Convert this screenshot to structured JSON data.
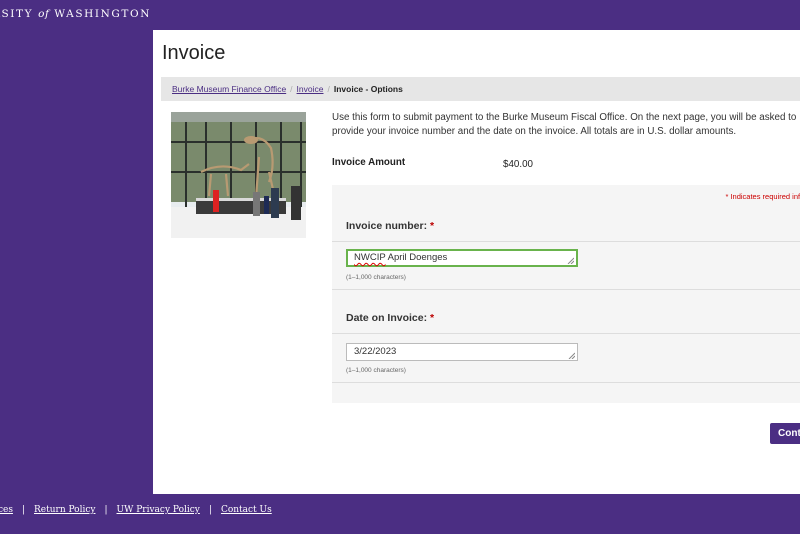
{
  "header": {
    "org_text_start": "RSITY ",
    "org_of": "of",
    "org_text_end": " WASHINGTON"
  },
  "page": {
    "title": "Invoice"
  },
  "breadcrumb": {
    "items": [
      "Burke Museum Finance Office",
      "Invoice"
    ],
    "current": "Invoice - Options",
    "separator": "/"
  },
  "intro_text": "Use this form to submit payment to the Burke Museum Fiscal Office. On the next page, you will be asked to provide your invoice number and the date on the invoice. All totals are in U.S. dollar amounts.",
  "invoice_amount": {
    "label": "Invoice Amount",
    "value": "$40.00"
  },
  "form": {
    "required_note": "* Indicates required inform",
    "questions": [
      {
        "label": "Invoice number:",
        "required": "*",
        "value_underlined": "NWCIP",
        "value_rest": " April Doenges",
        "hint": "(1–1,000 characters)"
      },
      {
        "label": "Date on Invoice:",
        "required": "*",
        "value": "3/22/2023",
        "hint": "(1–1,000 characters)"
      }
    ]
  },
  "continue_label": "Continue",
  "footer": {
    "links": [
      "vices",
      "Return Policy",
      "UW Privacy Policy",
      "Contact Us"
    ],
    "separator": "|"
  },
  "colors": {
    "brand_purple": "#4b2e83",
    "active_border": "#69b34c",
    "required": "#b00"
  }
}
